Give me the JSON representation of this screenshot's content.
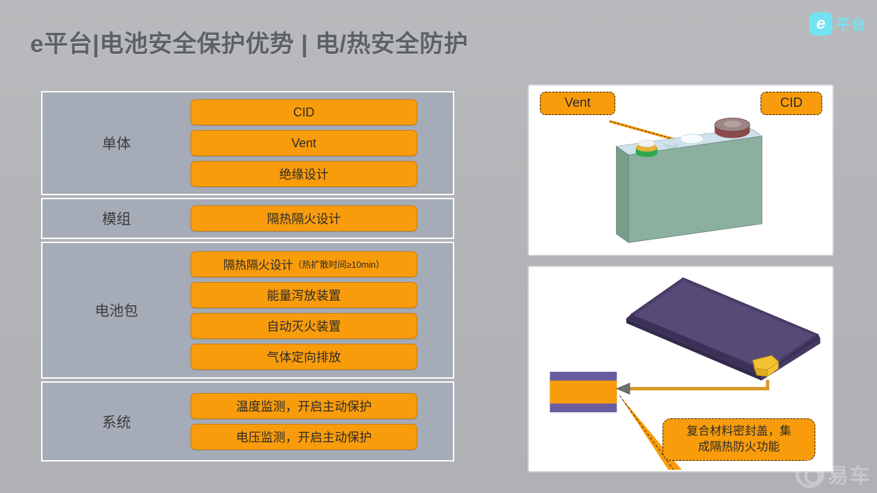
{
  "header": {
    "title": "e平台|电池安全保护优势 | 电/热安全防护",
    "brand_mark": "e",
    "brand_text": "平台",
    "title_color": "#5d6165",
    "brand_color": "#6fe6f5"
  },
  "theme": {
    "background": "#b3b4b7",
    "panel_background": "#a6acb7",
    "panel_border": "#ffffff",
    "chip_fill": "#f99c0b",
    "chip_border": "#c87d09",
    "chip_text": "#2b2b2b"
  },
  "matrix": {
    "rows": [
      {
        "label": "单体",
        "items": [
          {
            "text": "CID"
          },
          {
            "text": "Vent"
          },
          {
            "text": "绝缘设计"
          }
        ]
      },
      {
        "label": "模组",
        "items": [
          {
            "text": "隔热隔火设计"
          }
        ]
      },
      {
        "label": "电池包",
        "items": [
          {
            "text": "隔热隔火设计",
            "note": "（热扩散时间≥10min）"
          },
          {
            "text": "能量泻放装置"
          },
          {
            "text": "自动灭火装置"
          },
          {
            "text": "气体定向排放"
          }
        ]
      },
      {
        "label": "系统",
        "items": [
          {
            "text": "温度监测，开启主动保护"
          },
          {
            "text": "电压监测，开启主动保护"
          }
        ]
      }
    ]
  },
  "figures": {
    "cell": {
      "callout_vent": "Vent",
      "callout_cid": "CID",
      "body_color": "#84a894",
      "top_color": "#cfe2ec",
      "cid_disc_color": "#8b4b4b"
    },
    "pouch": {
      "caption_line1": "复合材料密封盖，集",
      "caption_line2": "成隔热防火功能",
      "body_color": "#4c3f6b",
      "tab_color": "#f2c233",
      "section_outer_color": "#6b5ca0",
      "section_inner_color": "#f99c0b"
    }
  },
  "watermark": {
    "text": "易车"
  }
}
